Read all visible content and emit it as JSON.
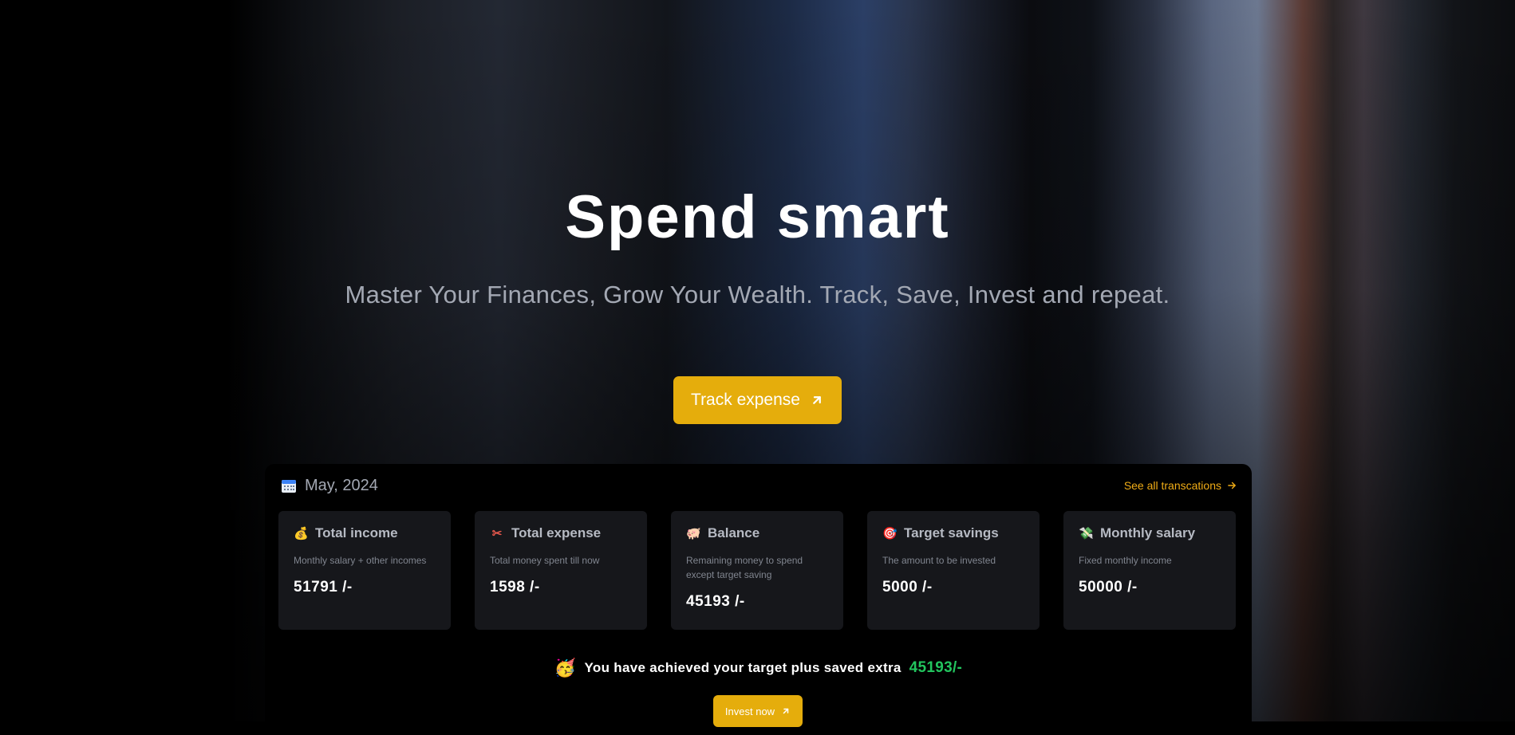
{
  "hero": {
    "title": "Spend smart",
    "subtitle": "Master Your Finances, Grow Your Wealth. Track, Save, Invest and repeat.",
    "cta_label": "Track expense"
  },
  "summary": {
    "month": "May, 2024",
    "see_all_label": "See all transcations",
    "cards": [
      {
        "icon": "money-bag-icon",
        "title": "Total income",
        "desc": "Monthly salary + other incomes",
        "value": "51791 /-"
      },
      {
        "icon": "scissors-icon",
        "title": "Total expense",
        "desc": "Total money spent till now",
        "value": "1598 /-"
      },
      {
        "icon": "pig-icon",
        "title": "Balance",
        "desc": "Remaining money to spend except target saving",
        "value": "45193 /-"
      },
      {
        "icon": "target-icon",
        "title": "Target savings",
        "desc": "The amount to be invested",
        "value": "5000 /-"
      },
      {
        "icon": "money-with-wings-icon",
        "title": "Monthly salary",
        "desc": "Fixed monthly income",
        "value": "50000 /-"
      }
    ],
    "achievement_text": "You have achieved your target plus saved extra",
    "achievement_amount": "45193/-",
    "invest_label": "Invest now"
  },
  "colors": {
    "accent": "#e5ad0c",
    "link": "#f0ac16",
    "success": "#22c55e",
    "card_bg": "#16171b"
  }
}
